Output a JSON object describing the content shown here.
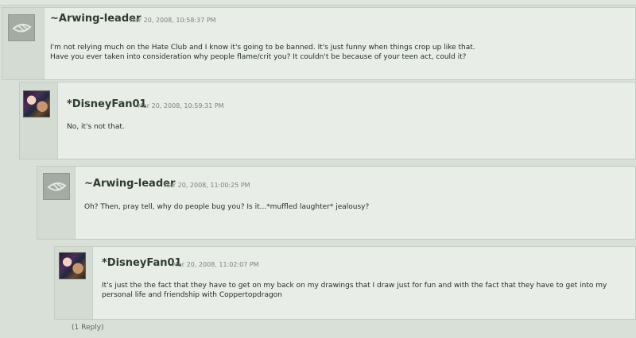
{
  "comments": [
    {
      "author": "~Arwing-leader",
      "timestamp": "Mar 20, 2008, 10:58:37 PM",
      "avatar_icon": "deviantart-default-avatar-icon",
      "body": [
        "I'm not relying much on the Hate Club and I know it's going to be banned. It's just funny when things crop up like that.",
        "Have you ever taken into consideration why people flame/crit you? It couldn't be because of your teen act, could it?"
      ]
    },
    {
      "author": "*DisneyFan01",
      "timestamp": "Mar 20, 2008, 10:59:31 PM",
      "avatar_icon": "user-photo-avatar-icon",
      "body": [
        "No, it's not that."
      ]
    },
    {
      "author": "~Arwing-leader",
      "timestamp": "Mar 20, 2008, 11:00:25 PM",
      "avatar_icon": "deviantart-default-avatar-icon",
      "body": [
        "Oh? Then, pray tell, why do people bug you? Is it...*muffled laughter* jealousy?"
      ]
    },
    {
      "author": "*DisneyFan01",
      "timestamp": "Mar 20, 2008, 11:02:07 PM",
      "avatar_icon": "user-photo-avatar-icon",
      "body": [
        "It's just the the fact that they have to get on my back on my drawings that I draw just for fun and with the fact that they have to get into my",
        "personal life and friendship with Coppertopdragon"
      ]
    }
  ],
  "replies_link": "(1 Reply)",
  "colors": {
    "background": "#d9e0d8",
    "panel": "#e8ede7",
    "border": "#c2ccc1",
    "author_text": "#2d3c2c"
  }
}
